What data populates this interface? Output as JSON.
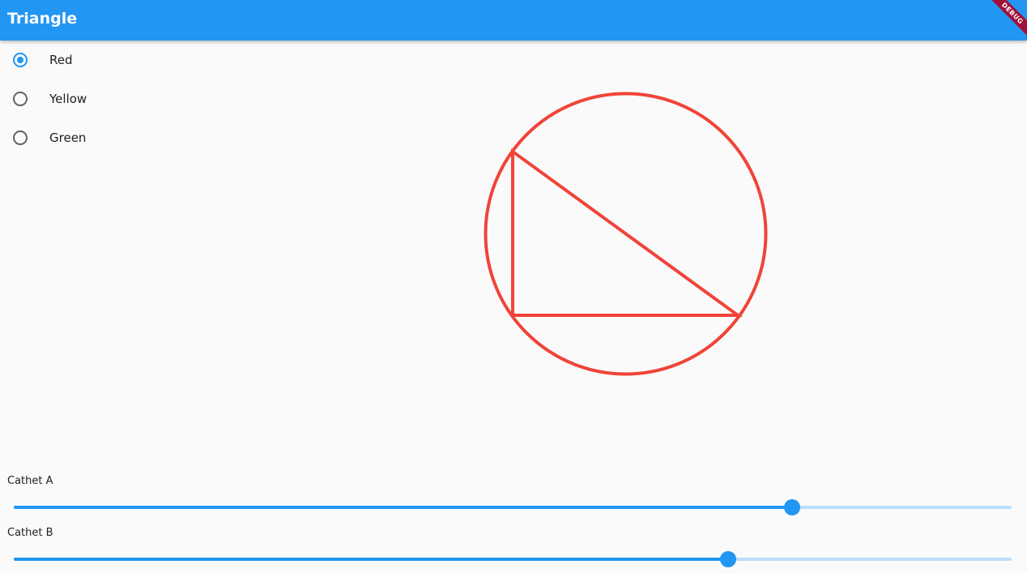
{
  "appbar": {
    "title": "Triangle",
    "debug_label": "DEBUG",
    "color": "#2196f3"
  },
  "radio_group": {
    "options": [
      {
        "label": "Red",
        "selected": true
      },
      {
        "label": "Yellow",
        "selected": false
      },
      {
        "label": "Green",
        "selected": false
      }
    ]
  },
  "figure": {
    "stroke_color": "#f04438",
    "shapes": [
      "circumcircle",
      "right-triangle"
    ]
  },
  "sliders": [
    {
      "label": "Cathet A",
      "value": 0.78
    },
    {
      "label": "Cathet B",
      "value": 0.716
    }
  ]
}
